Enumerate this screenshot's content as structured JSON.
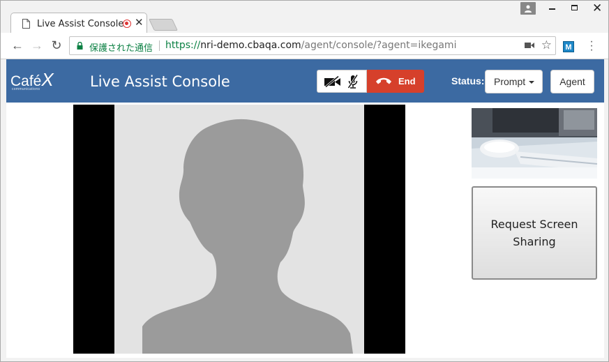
{
  "browser": {
    "tab_title": "Live Assist Console",
    "secure_label": "保護された通信",
    "url_scheme": "https://",
    "url_host": "nri-demo.cbaqa.com",
    "url_path": "/agent/console/?agent=ikegami",
    "extension_letter": "M"
  },
  "header": {
    "logo_text": "Café",
    "logo_mark": "X",
    "logo_tagline": "communications",
    "title": "Live Assist Console",
    "end_label": "End",
    "status_label": "Status:",
    "status_value": "Prompt",
    "agent_label": "Agent"
  },
  "main": {
    "screen_share_label": "Request Screen Sharing"
  },
  "colors": {
    "header_bg": "#3c6aa2",
    "end_button": "#d6402b",
    "secure_green": "#0b8043"
  }
}
